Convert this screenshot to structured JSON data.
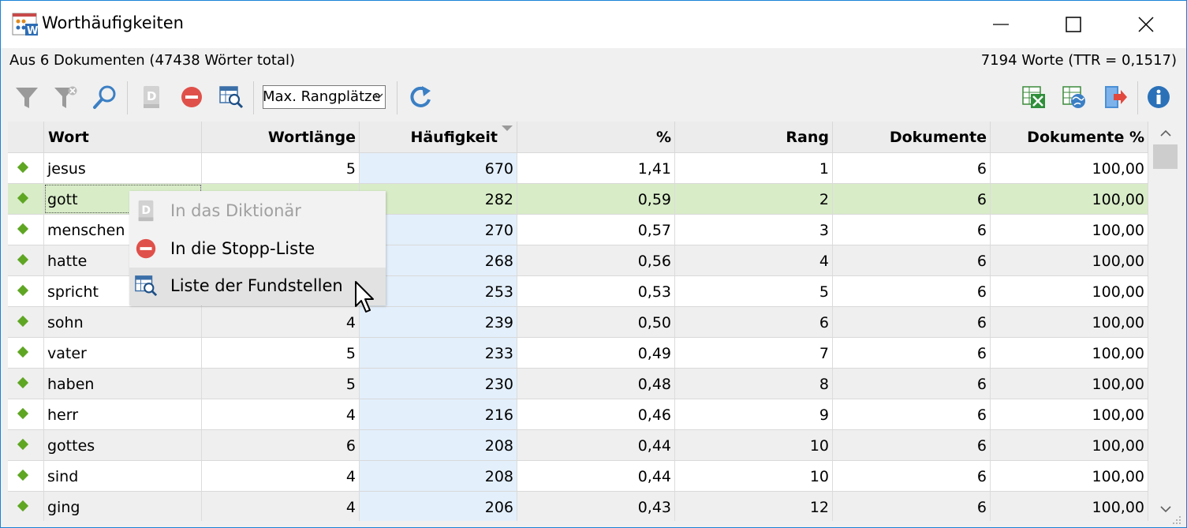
{
  "window": {
    "title": "Worthäufigkeiten",
    "controls": {
      "minimize": "minimize",
      "maximize": "maximize",
      "close": "close"
    }
  },
  "info": {
    "left": "Aus 6 Dokumenten (47438 Wörter total)",
    "right": "7194 Worte (TTR = 0,1517)"
  },
  "toolbar": {
    "combo_value": "Max. Rangplätze",
    "icons": [
      "filter-icon",
      "filter-clear-icon",
      "search-icon",
      "dictionary-icon",
      "stop-list-icon",
      "keyword-in-context-icon",
      "refresh-icon",
      "export-excel-icon",
      "export-html-icon",
      "export-icon",
      "info-icon"
    ]
  },
  "table": {
    "columns": [
      "Wort",
      "Wortlänge",
      "Häufigkeit",
      "%",
      "Rang",
      "Dokumente",
      "Dokumente %"
    ],
    "sorted_column": "Häufigkeit",
    "rows": [
      [
        "jesus",
        "5",
        "670",
        "1,41",
        "1",
        "6",
        "100,00"
      ],
      [
        "gott",
        "",
        "282",
        "0,59",
        "2",
        "6",
        "100,00"
      ],
      [
        "menschen",
        "",
        "270",
        "0,57",
        "3",
        "6",
        "100,00"
      ],
      [
        "hatte",
        "",
        "268",
        "0,56",
        "4",
        "6",
        "100,00"
      ],
      [
        "spricht",
        "",
        "253",
        "0,53",
        "5",
        "6",
        "100,00"
      ],
      [
        "sohn",
        "4",
        "239",
        "0,50",
        "6",
        "6",
        "100,00"
      ],
      [
        "vater",
        "5",
        "233",
        "0,49",
        "7",
        "6",
        "100,00"
      ],
      [
        "haben",
        "5",
        "230",
        "0,48",
        "8",
        "6",
        "100,00"
      ],
      [
        "herr",
        "4",
        "216",
        "0,46",
        "9",
        "6",
        "100,00"
      ],
      [
        "gottes",
        "6",
        "208",
        "0,44",
        "10",
        "6",
        "100,00"
      ],
      [
        "sind",
        "4",
        "208",
        "0,44",
        "10",
        "6",
        "100,00"
      ],
      [
        "ging",
        "4",
        "206",
        "0,43",
        "12",
        "6",
        "100,00"
      ]
    ],
    "selected_row": 1,
    "marker_color": "#5fa623",
    "selection_color": "#d8ecc8"
  },
  "context_menu": {
    "items": [
      {
        "label": "In das Diktionär",
        "icon": "dictionary-icon",
        "disabled": true
      },
      {
        "label": "In die Stopp-Liste",
        "icon": "stop-list-icon",
        "disabled": false
      },
      {
        "label": "Liste der Fundstellen",
        "icon": "keyword-in-context-icon",
        "disabled": false,
        "hover": true
      }
    ]
  }
}
